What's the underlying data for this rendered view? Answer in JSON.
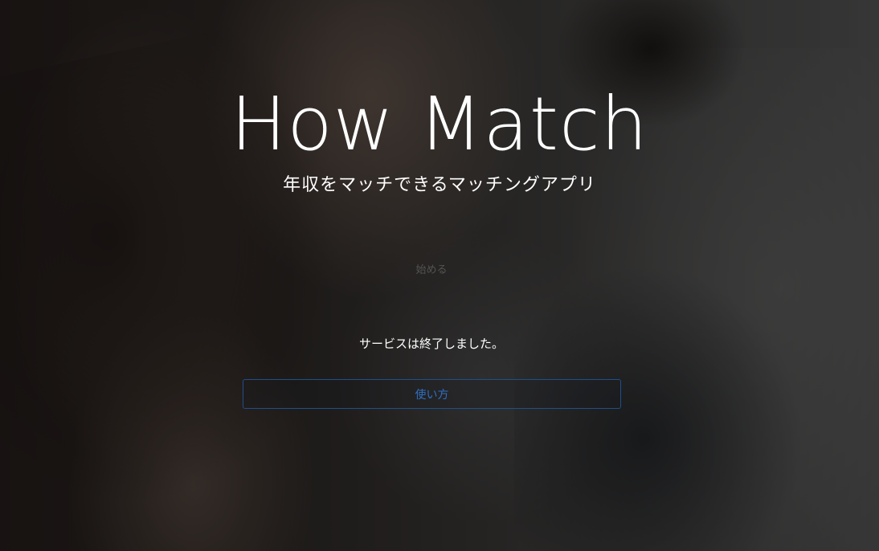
{
  "hero": {
    "title": "How Match",
    "subtitle": "年収をマッチできるマッチングアプリ"
  },
  "actions": {
    "start_label": "始める",
    "howto_label": "使い方"
  },
  "notice": {
    "text": "サービスは終了しました。"
  },
  "colors": {
    "title": "#ffffff",
    "button_border": "#1f4f8a",
    "button_text": "#2f6fc4"
  }
}
